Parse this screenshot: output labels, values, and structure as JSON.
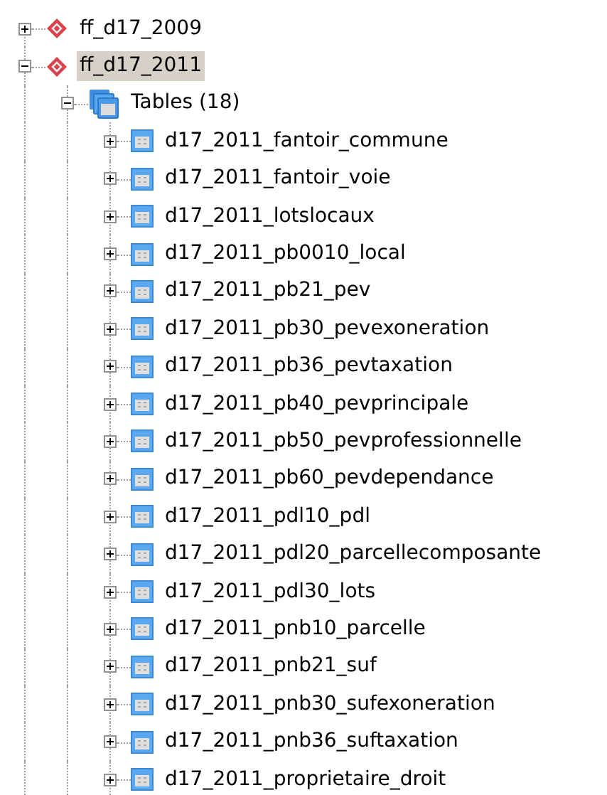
{
  "tree": [
    {
      "label": "ff_d17_2009",
      "kind": "database",
      "expanded": false,
      "selected": false
    },
    {
      "label": "ff_d17_2011",
      "kind": "database",
      "expanded": true,
      "selected": true,
      "children": [
        {
          "label": "Tables (18)",
          "kind": "table-group",
          "expanded": true,
          "selected": false,
          "children": [
            {
              "label": "d17_2011_fantoir_commune",
              "kind": "table",
              "expanded": false,
              "selected": false
            },
            {
              "label": "d17_2011_fantoir_voie",
              "kind": "table",
              "expanded": false,
              "selected": false
            },
            {
              "label": "d17_2011_lotslocaux",
              "kind": "table",
              "expanded": false,
              "selected": false
            },
            {
              "label": "d17_2011_pb0010_local",
              "kind": "table",
              "expanded": false,
              "selected": false
            },
            {
              "label": "d17_2011_pb21_pev",
              "kind": "table",
              "expanded": false,
              "selected": false
            },
            {
              "label": "d17_2011_pb30_pevexoneration",
              "kind": "table",
              "expanded": false,
              "selected": false
            },
            {
              "label": "d17_2011_pb36_pevtaxation",
              "kind": "table",
              "expanded": false,
              "selected": false
            },
            {
              "label": "d17_2011_pb40_pevprincipale",
              "kind": "table",
              "expanded": false,
              "selected": false
            },
            {
              "label": "d17_2011_pb50_pevprofessionnelle",
              "kind": "table",
              "expanded": false,
              "selected": false
            },
            {
              "label": "d17_2011_pb60_pevdependance",
              "kind": "table",
              "expanded": false,
              "selected": false
            },
            {
              "label": "d17_2011_pdl10_pdl",
              "kind": "table",
              "expanded": false,
              "selected": false
            },
            {
              "label": "d17_2011_pdl20_parcellecomposante",
              "kind": "table",
              "expanded": false,
              "selected": false
            },
            {
              "label": "d17_2011_pdl30_lots",
              "kind": "table",
              "expanded": false,
              "selected": false
            },
            {
              "label": "d17_2011_pnb10_parcelle",
              "kind": "table",
              "expanded": false,
              "selected": false
            },
            {
              "label": "d17_2011_pnb21_suf",
              "kind": "table",
              "expanded": false,
              "selected": false
            },
            {
              "label": "d17_2011_pnb30_sufexoneration",
              "kind": "table",
              "expanded": false,
              "selected": false
            },
            {
              "label": "d17_2011_pnb36_suftaxation",
              "kind": "table",
              "expanded": false,
              "selected": false
            },
            {
              "label": "d17_2011_proprietaire_droit",
              "kind": "table",
              "expanded": false,
              "selected": false
            }
          ]
        }
      ]
    }
  ]
}
